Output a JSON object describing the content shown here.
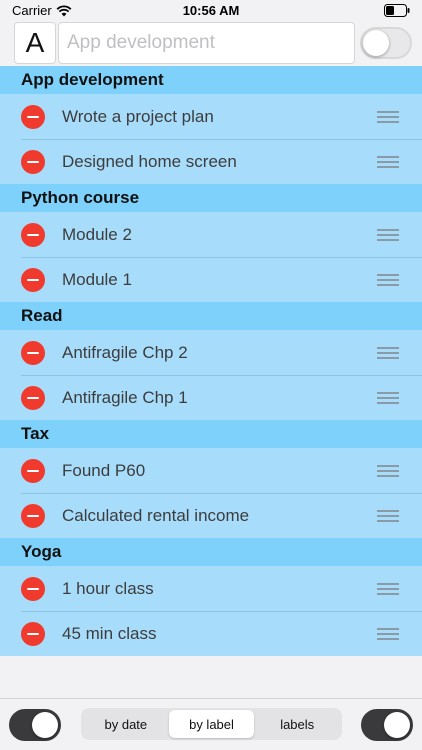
{
  "status_bar": {
    "carrier": "Carrier",
    "time": "10:56 AM"
  },
  "top_bar": {
    "letter_button": "A",
    "search_placeholder": "App development",
    "toggle_state": "off"
  },
  "sections": [
    {
      "title": "App development",
      "items": [
        "Wrote a project plan",
        "Designed home screen"
      ]
    },
    {
      "title": "Python course",
      "items": [
        "Module 2",
        "Module 1"
      ]
    },
    {
      "title": "Read",
      "items": [
        "Antifragile Chp 2",
        "Antifragile Chp 1"
      ]
    },
    {
      "title": "Tax",
      "items": [
        "Found P60",
        "Calculated rental income"
      ]
    },
    {
      "title": "Yoga",
      "items": [
        "1 hour class",
        "45 min class"
      ]
    }
  ],
  "bottom_bar": {
    "left_toggle_state": "on",
    "right_toggle_state": "on",
    "segments": [
      "by date",
      "by label",
      "labels"
    ],
    "selected_segment": "by label"
  },
  "colors": {
    "list_bg": "#a7dcfb",
    "section_header_bg": "#7ed1fb",
    "delete_red": "#f03a2e"
  }
}
